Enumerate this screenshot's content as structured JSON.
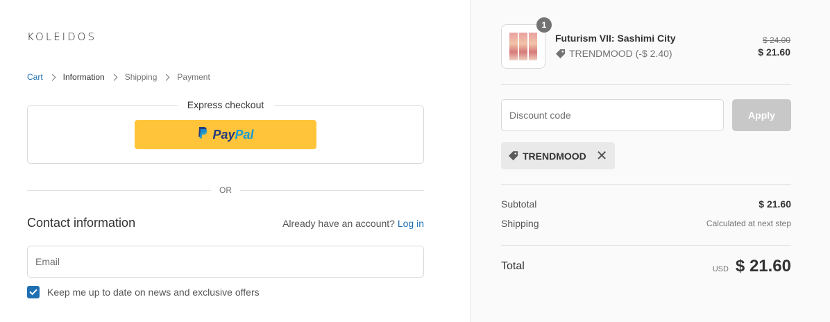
{
  "store": {
    "logo_text": "KOLEIDOS"
  },
  "breadcrumb": {
    "items": [
      {
        "label": "Cart"
      },
      {
        "label": "Information"
      },
      {
        "label": "Shipping"
      },
      {
        "label": "Payment"
      }
    ]
  },
  "express_checkout": {
    "title": "Express checkout",
    "paypal_pay": "Pay",
    "paypal_pal": "Pal",
    "paypal_icon": "paypal-logo",
    "button_color": "#ffc439"
  },
  "divider_text": "OR",
  "contact": {
    "title": "Contact information",
    "account_prompt": "Already have an account?",
    "login_label": "Log in",
    "email_placeholder": "Email",
    "newsletter_label": "Keep me up to date on news and exclusive offers",
    "newsletter_checked": true
  },
  "order": {
    "product": {
      "name": "Futurism VII: Sashimi City",
      "quantity": "1",
      "discount_label": "TRENDMOOD (-$ 2.40)",
      "original_price": "$ 24.00",
      "price": "$ 21.60"
    },
    "discount_placeholder": "Discount code",
    "apply_label": "Apply",
    "applied_code": "TRENDMOOD",
    "subtotal_label": "Subtotal",
    "subtotal_value": "$ 21.60",
    "shipping_label": "Shipping",
    "shipping_value": "Calculated at next step",
    "total_label": "Total",
    "currency": "USD",
    "total_value": "$ 21.60"
  },
  "colors": {
    "accent": "#1f6fb3",
    "paypal_yellow": "#ffc439",
    "paypal_dark": "#253b80",
    "paypal_light": "#179bd7"
  }
}
